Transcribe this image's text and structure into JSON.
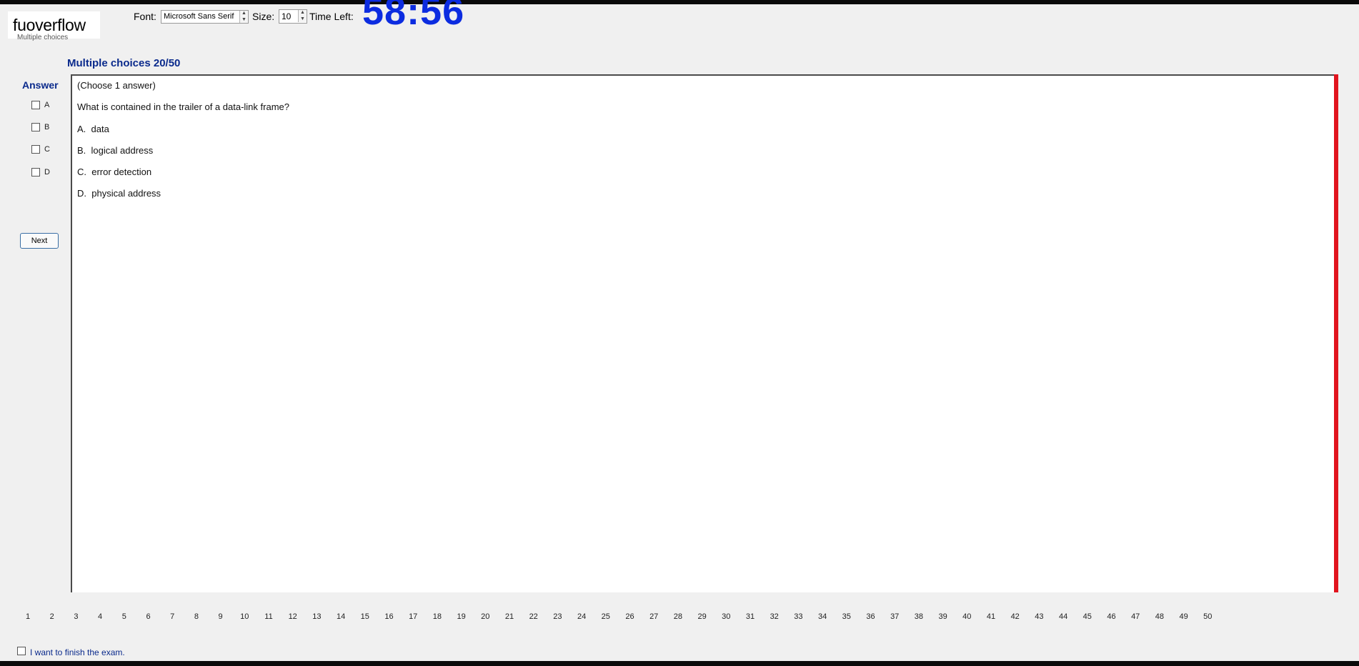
{
  "watermark": "fuoverflow",
  "header": {
    "font_label": "Font:",
    "font_value": "Microsoft Sans Serif",
    "size_label": "Size:",
    "size_value": "10",
    "time_left_label": "Time Left:",
    "timer": "58:56"
  },
  "section": {
    "title": "Multiple choices 20/50",
    "sub_caption": "Multiple choices"
  },
  "answer": {
    "label": "Answer",
    "options": [
      "A",
      "B",
      "C",
      "D"
    ]
  },
  "next_label": "Next",
  "question": {
    "instruction": "(Choose 1 answer)",
    "text": "What is contained in the trailer of a data-link frame?",
    "choices": [
      {
        "letter": "A.",
        "text": "data"
      },
      {
        "letter": "B.",
        "text": "logical address"
      },
      {
        "letter": "C.",
        "text": "error detection"
      },
      {
        "letter": "D.",
        "text": "physical address"
      }
    ]
  },
  "pages": [
    "1",
    "2",
    "3",
    "4",
    "5",
    "6",
    "7",
    "8",
    "9",
    "10",
    "11",
    "12",
    "13",
    "14",
    "15",
    "16",
    "17",
    "18",
    "19",
    "20",
    "21",
    "22",
    "23",
    "24",
    "25",
    "26",
    "27",
    "28",
    "29",
    "30",
    "31",
    "32",
    "33",
    "34",
    "35",
    "36",
    "37",
    "38",
    "39",
    "40",
    "41",
    "42",
    "43",
    "44",
    "45",
    "46",
    "47",
    "48",
    "49",
    "50"
  ],
  "finish_label": "I want to finish the exam.",
  "colors": {
    "timer": "#0c2ce0",
    "title": "#0a2a8c",
    "panel_edge": "#e1141e",
    "background": "#f0f0f0"
  }
}
